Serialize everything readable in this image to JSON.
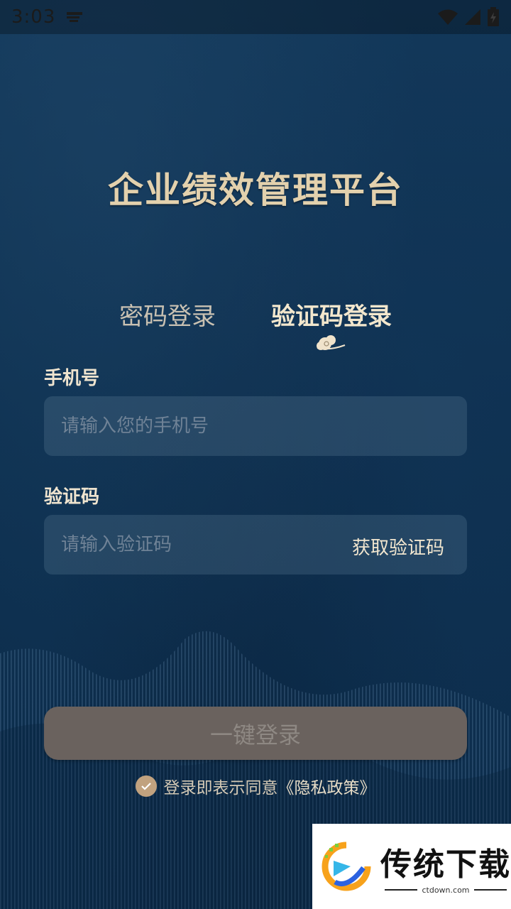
{
  "status_bar": {
    "time": "3:03",
    "icons": [
      "notification-icon",
      "wifi-icon",
      "signal-icon",
      "battery-icon"
    ]
  },
  "app": {
    "title": "企业绩效管理平台"
  },
  "tabs": [
    {
      "label": "密码登录",
      "active": false
    },
    {
      "label": "验证码登录",
      "active": true
    }
  ],
  "form": {
    "phone_label": "手机号",
    "phone_placeholder": "请输入您的手机号",
    "phone_value": "",
    "code_label": "验证码",
    "code_placeholder": "请输入验证码",
    "code_value": "",
    "get_code_label": "获取验证码"
  },
  "login_button": {
    "label": "一键登录",
    "enabled": false
  },
  "agreement": {
    "checked": true,
    "text": "登录即表示同意",
    "link": "《隐私政策》"
  },
  "watermark": {
    "brand": "传统下载",
    "url": "ctdown.com"
  },
  "colors": {
    "background": "#0f3251",
    "title_gold": "#e3d1ad",
    "input_bg": "#2a4c6a",
    "button_bg": "#6a625e",
    "check_bg": "#c1a27f"
  }
}
